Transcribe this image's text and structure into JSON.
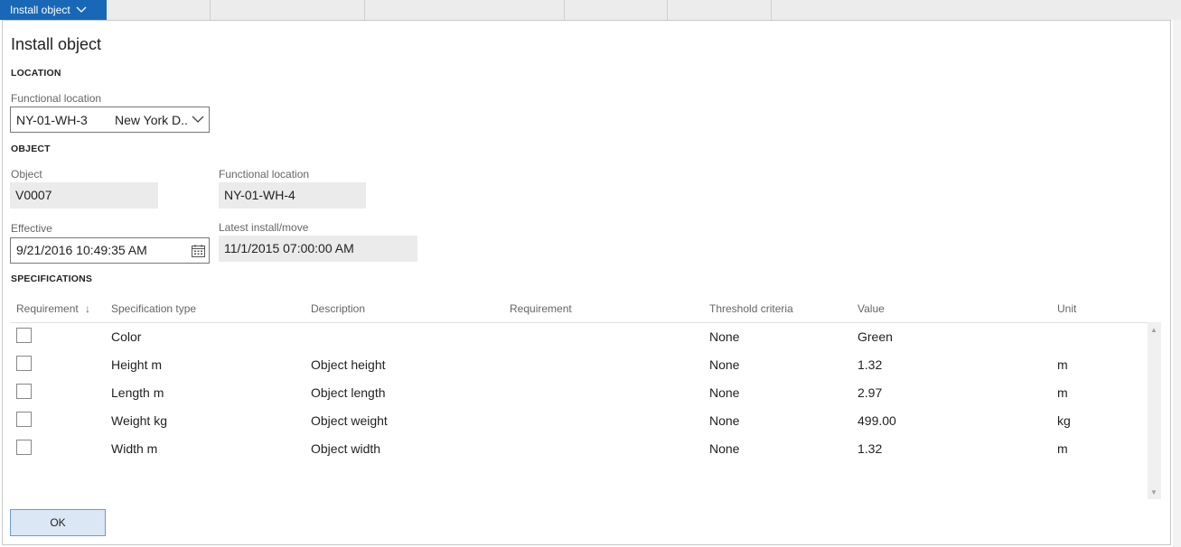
{
  "tabstrip": {
    "active_tab": "Install object"
  },
  "dialog": {
    "title": "Install object",
    "location": {
      "section_label": "LOCATION",
      "functional_location_label": "Functional location",
      "functional_location_code": "NY-01-WH-3",
      "functional_location_name": "New York D..."
    },
    "object": {
      "section_label": "OBJECT",
      "object_label": "Object",
      "object_value": "V0007",
      "functional_location_label": "Functional location",
      "functional_location_value": "NY-01-WH-4",
      "effective_label": "Effective",
      "effective_value": "9/21/2016 10:49:35 AM",
      "latest_install_label": "Latest install/move",
      "latest_install_value": "11/1/2015 07:00:00 AM"
    },
    "specifications": {
      "section_label": "SPECIFICATIONS",
      "columns": [
        "Requirement",
        "Specification type",
        "Description",
        "Requirement",
        "Threshold criteria",
        "Value",
        "Unit"
      ],
      "sort_indicator": "↓",
      "rows": [
        {
          "requirement": false,
          "spec_type": "Color",
          "description": "",
          "requirement_text": "",
          "threshold": "None",
          "value": "Green",
          "unit": ""
        },
        {
          "requirement": false,
          "spec_type": "Height m",
          "description": "Object height",
          "requirement_text": "",
          "threshold": "None",
          "value": "1.32",
          "unit": "m"
        },
        {
          "requirement": false,
          "spec_type": "Length m",
          "description": "Object length",
          "requirement_text": "",
          "threshold": "None",
          "value": "2.97",
          "unit": "m"
        },
        {
          "requirement": false,
          "spec_type": "Weight kg",
          "description": "Object weight",
          "requirement_text": "",
          "threshold": "None",
          "value": "499.00",
          "unit": "kg"
        },
        {
          "requirement": false,
          "spec_type": "Width m",
          "description": "Object width",
          "requirement_text": "",
          "threshold": "None",
          "value": "1.32",
          "unit": "m"
        }
      ]
    },
    "ok_label": "OK"
  },
  "colors": {
    "accent": "#1868b7",
    "readonly_bg": "#ebebeb",
    "button_bg": "#dbe7f4"
  },
  "icons": {
    "tab_chevron": "chevron-down-icon",
    "combo_chevron": "chevron-down-icon",
    "calendar": "calendar-icon"
  }
}
